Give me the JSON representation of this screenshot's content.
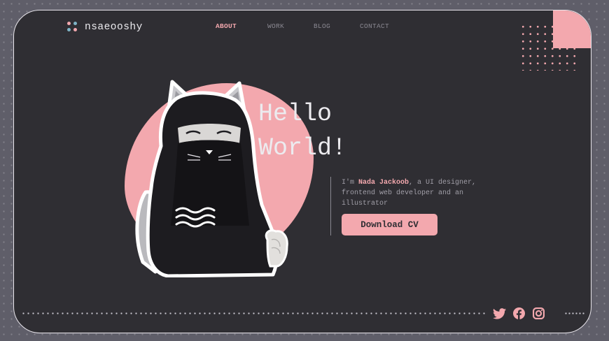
{
  "colors": {
    "accent": "#f3a8ae",
    "dark_bg": "#2f2e33",
    "outer_bg": "#5f5e69",
    "logo_dot_blue": "#7fb5c7"
  },
  "brand": {
    "name": "nsaeooshy",
    "icon": "four-dots-logo-icon"
  },
  "nav": {
    "items": [
      {
        "label": "ABOUT",
        "active": true
      },
      {
        "label": "WORK",
        "active": false
      },
      {
        "label": "BLOG",
        "active": false
      },
      {
        "label": "CONTACT",
        "active": false
      }
    ]
  },
  "hero": {
    "heading_line1": "Hello",
    "heading_line2": "World!",
    "intro_prefix": "I'm ",
    "intro_name": "Nada Jackoob",
    "intro_suffix": ", a UI designer, frontend web developer and an illustrator",
    "cta_label": "Download CV"
  },
  "social": [
    {
      "name": "twitter",
      "icon": "twitter-icon"
    },
    {
      "name": "facebook",
      "icon": "facebook-icon"
    },
    {
      "name": "instagram",
      "icon": "instagram-icon"
    }
  ]
}
